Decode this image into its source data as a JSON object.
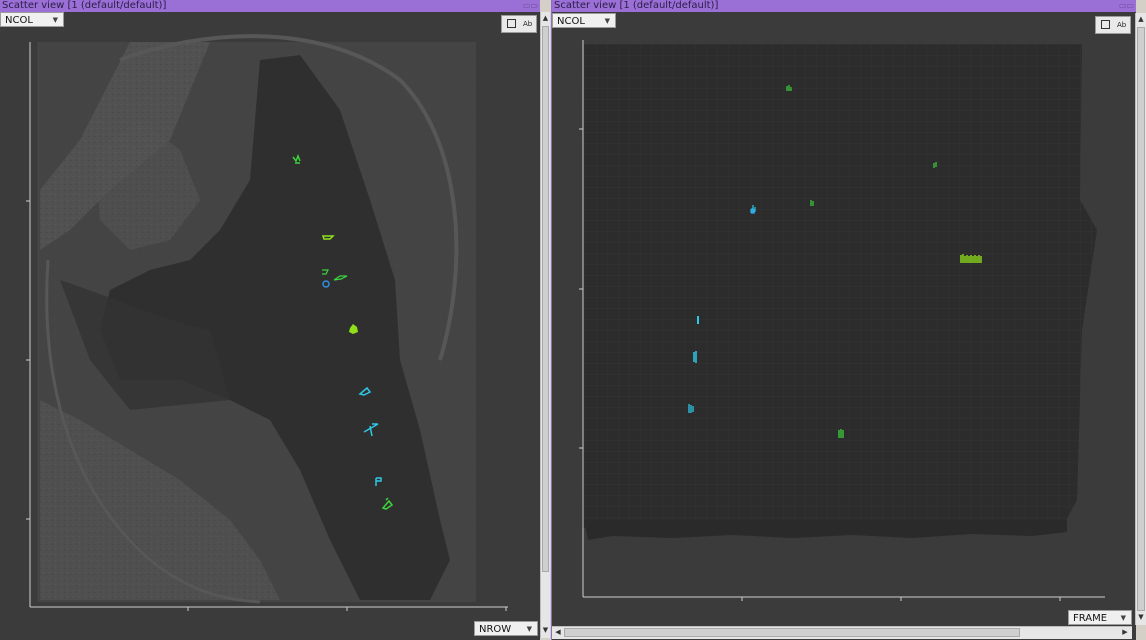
{
  "panels": [
    {
      "title": "Scatter view [1 (default/default)]",
      "x_selector": "NCOL",
      "y_selector": "NROW",
      "tool_icon": "export-image-icon",
      "label_icon": "label-toggle-icon",
      "tool_label": "Ab"
    },
    {
      "title": "Scatter view [1 (default/default)]",
      "x_selector": "NCOL",
      "y_selector": "FRAME",
      "tool_icon": "export-image-icon",
      "label_icon": "label-toggle-icon",
      "tool_label": "Ab"
    }
  ],
  "colors": {
    "title_bar": "#9a6fd6",
    "plot_bg": "#3b3b3b",
    "cluster_green": "#3bd43b",
    "cluster_lime": "#8fe01a",
    "cluster_cyan": "#2ec8e6",
    "cluster_blue": "#2f8fe0"
  }
}
